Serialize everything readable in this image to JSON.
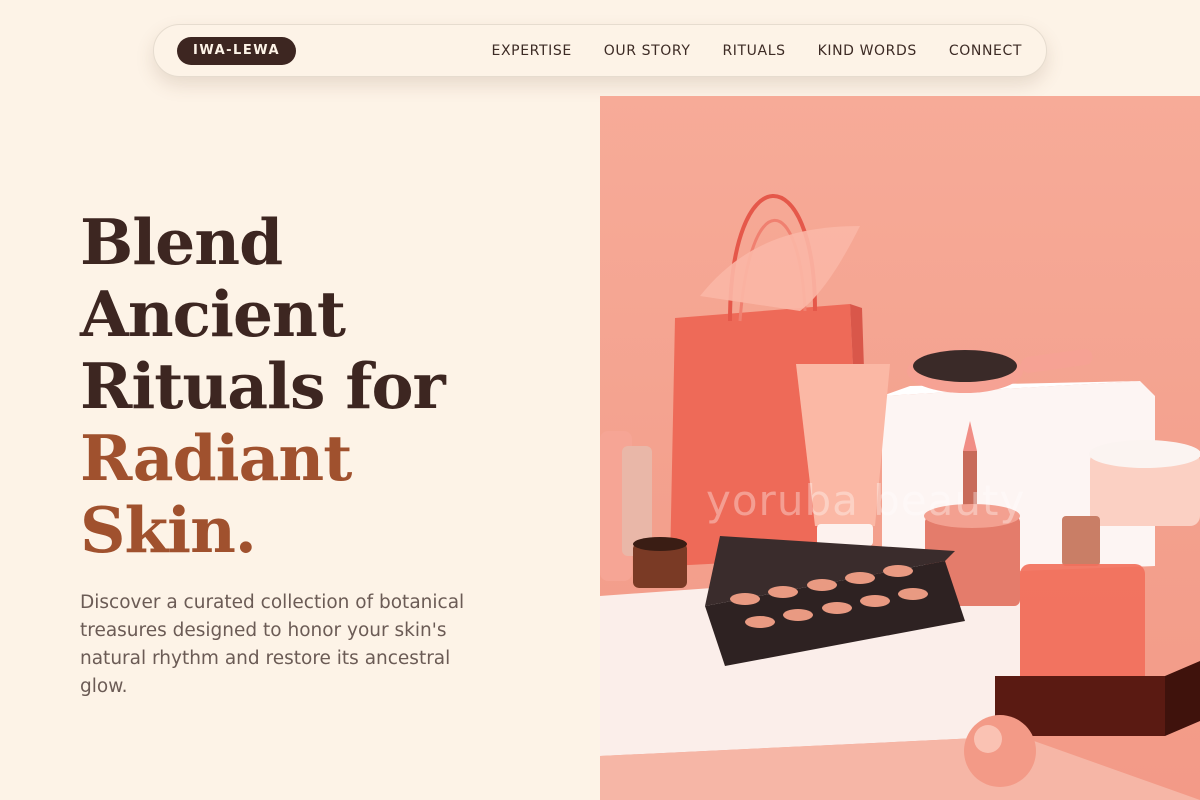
{
  "nav": {
    "logo": "IWA-LEWA",
    "links": [
      "EXPERTISE",
      "OUR STORY",
      "RITUALS",
      "KIND WORDS",
      "CONNECT"
    ]
  },
  "hero": {
    "headline_lines": [
      "Blend",
      "Ancient",
      "Rituals for"
    ],
    "headline_accent_lines": [
      "Radiant",
      "Skin."
    ],
    "description": "Discover a curated collection of botanical treasures designed to honor your skin's natural rhythm and restore its ancestral glow.",
    "image": {
      "subject": "cosmetics-products-photo",
      "watermark_text": "yoruba beauty"
    }
  },
  "colors": {
    "background": "#fdf3e7",
    "brand_dark": "#3d2621",
    "accent": "#a0512e",
    "body_text": "#6b5b55",
    "image_bg": "#f7ab98"
  }
}
